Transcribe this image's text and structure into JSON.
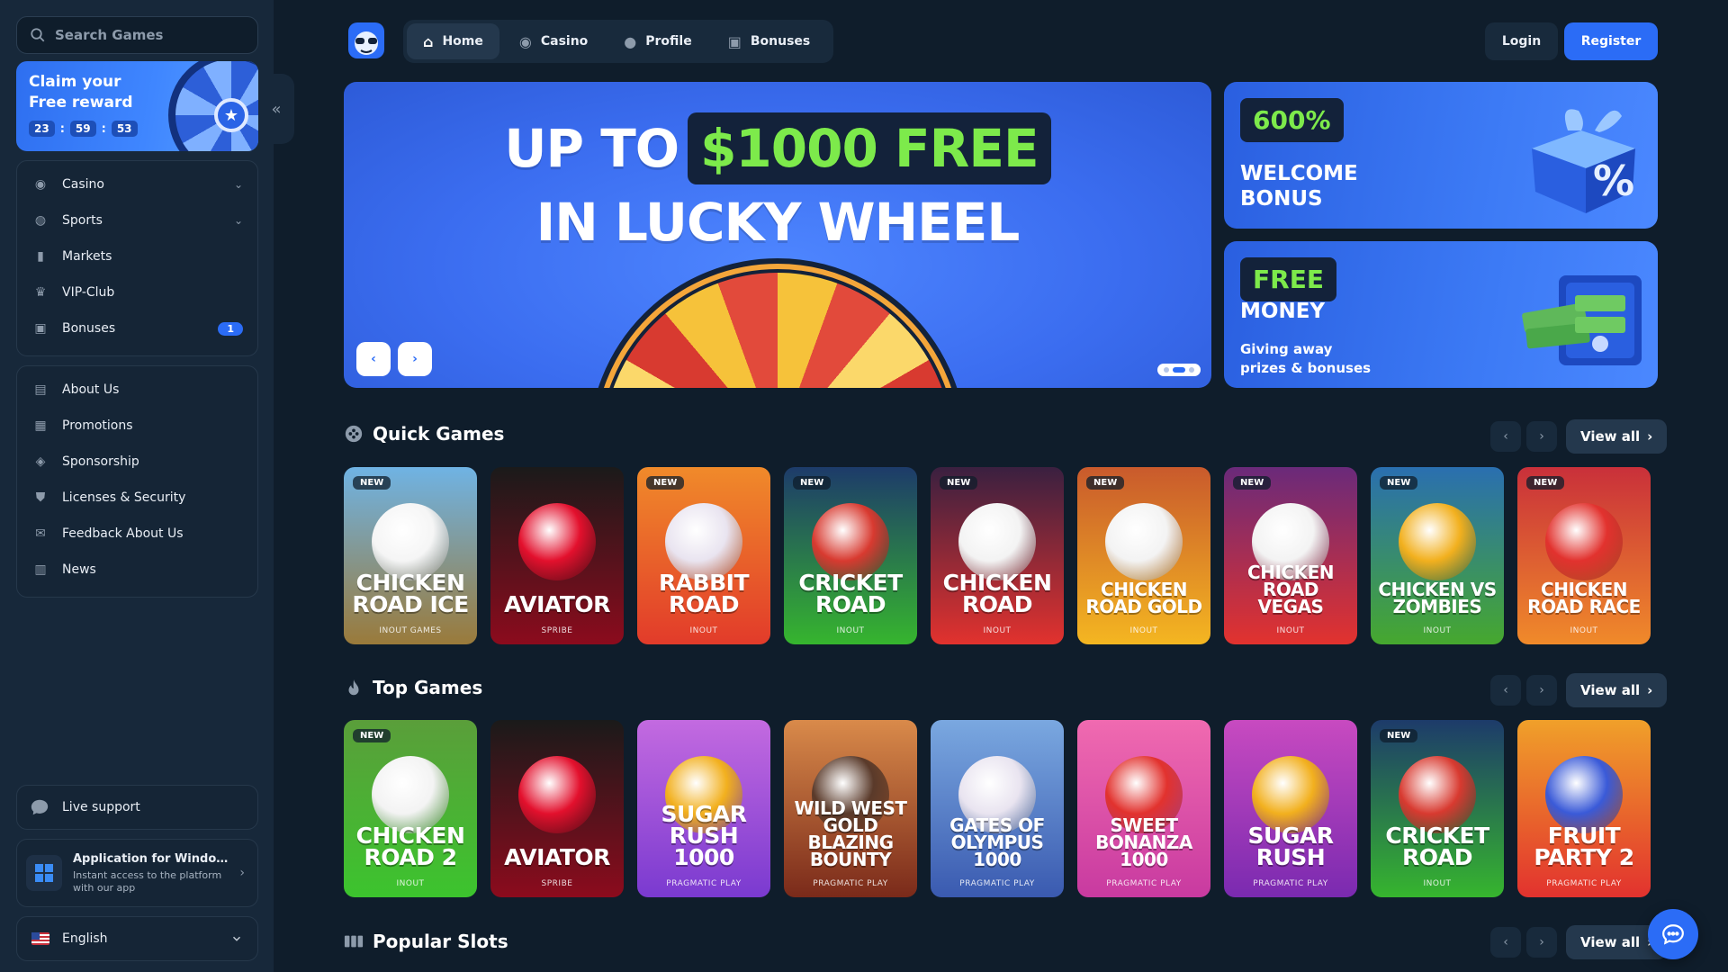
{
  "sidebar": {
    "search_placeholder": "Search Games",
    "claim": {
      "title": "Claim your Free reward",
      "hours": "23",
      "minutes": "59",
      "seconds": "53"
    },
    "nav_primary": [
      {
        "label": "Casino",
        "icon": "casino-chip-icon",
        "expandable": true
      },
      {
        "label": "Sports",
        "icon": "globe-ball-icon",
        "expandable": true
      },
      {
        "label": "Markets",
        "icon": "candles-chart-icon"
      },
      {
        "label": "VIP-Club",
        "icon": "crown-icon"
      },
      {
        "label": "Bonuses",
        "icon": "gift-icon",
        "badge": "1"
      }
    ],
    "nav_secondary": [
      {
        "label": "About Us",
        "icon": "book-icon"
      },
      {
        "label": "Promotions",
        "icon": "ticket-icon"
      },
      {
        "label": "Sponsorship",
        "icon": "medal-icon"
      },
      {
        "label": "Licenses & Security",
        "icon": "shield-icon"
      },
      {
        "label": "Feedback About Us",
        "icon": "chat-bubble-icon"
      },
      {
        "label": "News",
        "icon": "newspaper-icon"
      }
    ],
    "live_support": "Live support",
    "app": {
      "title": "Application for Windows",
      "subtitle": "Instant access to the platform with our app"
    },
    "language": "English"
  },
  "header": {
    "tabs": [
      {
        "label": "Home",
        "icon": "home-icon",
        "active": true
      },
      {
        "label": "Casino",
        "icon": "casino-chip-icon"
      },
      {
        "label": "Profile",
        "icon": "user-icon"
      },
      {
        "label": "Bonuses",
        "icon": "gift-icon"
      }
    ],
    "login": "Login",
    "register": "Register"
  },
  "hero": {
    "line1_a": "UP TO",
    "line1_b": "$1000 FREE",
    "line2": "IN LUCKY WHEEL",
    "slides": 3,
    "active_slide": 2
  },
  "promos": [
    {
      "pill": "600%",
      "title": "WELCOME BONUS",
      "subtitle": ""
    },
    {
      "pill": "FREE",
      "title": "MONEY",
      "subtitle": "Giving away prizes & bonuses"
    }
  ],
  "sections": {
    "quick": {
      "title": "Quick Games",
      "view_all": "View all",
      "games": [
        {
          "name": "CHICKEN ROAD ICE",
          "provider": "INOUT GAMES",
          "new": true,
          "bg": "#6fb3e4",
          "bg2": "#9a7a3a",
          "art": "#f5f5f5"
        },
        {
          "name": "AVIATOR",
          "provider": "SPRIBE",
          "new": false,
          "bg": "#1a1a1a",
          "bg2": "#8c0b1d",
          "art": "#e3102d"
        },
        {
          "name": "RABBIT ROAD",
          "provider": "INOUT",
          "new": true,
          "bg": "#f08a2a",
          "bg2": "#e23b2a",
          "art": "#e9e4f0"
        },
        {
          "name": "CRICKET ROAD",
          "provider": "INOUT",
          "new": true,
          "bg": "#1d3b6a",
          "bg2": "#36b52e",
          "art": "#d83a30"
        },
        {
          "name": "CHICKEN ROAD",
          "provider": "INOUT",
          "new": true,
          "bg": "#3a2040",
          "bg2": "#e2322e",
          "art": "#f3f3f3"
        },
        {
          "name": "CHICKEN ROAD GOLD",
          "provider": "INOUT",
          "new": true,
          "bg": "#c95a2c",
          "bg2": "#f4b621",
          "art": "#f3f3f3"
        },
        {
          "name": "CHICKEN ROAD VEGAS",
          "provider": "INOUT",
          "new": true,
          "bg": "#6a2a7a",
          "bg2": "#e2322e",
          "art": "#f3f3f3"
        },
        {
          "name": "CHICKEN VS ZOMBIES",
          "provider": "INOUT",
          "new": true,
          "bg": "#2a6fb0",
          "bg2": "#46a82e",
          "art": "#f2b01e"
        },
        {
          "name": "CHICKEN ROAD RACE",
          "provider": "INOUT",
          "new": true,
          "bg": "#c9303a",
          "bg2": "#f08a2a",
          "art": "#e2322e"
        }
      ]
    },
    "top": {
      "title": "Top Games",
      "view_all": "View all",
      "games": [
        {
          "name": "CHICKEN ROAD 2",
          "provider": "INOUT",
          "new": true,
          "bg": "#5a9e3a",
          "bg2": "#3cc42e",
          "art": "#f3f3f3"
        },
        {
          "name": "AVIATOR",
          "provider": "SPRIBE",
          "new": false,
          "bg": "#1a1a1a",
          "bg2": "#8c0b1d",
          "art": "#e3102d"
        },
        {
          "name": "SUGAR RUSH 1000",
          "provider": "PRAGMATIC PLAY",
          "new": false,
          "bg": "#c36ae0",
          "bg2": "#7a3ad0",
          "art": "#f2b01e"
        },
        {
          "name": "WILD WEST GOLD BLAZING BOUNTY",
          "provider": "PRAGMATIC PLAY",
          "new": false,
          "bg": "#d98a4a",
          "bg2": "#7a2a1a",
          "art": "#5a3a2a"
        },
        {
          "name": "GATES OF OLYMPUS 1000",
          "provider": "PRAGMATIC PLAY",
          "new": false,
          "bg": "#7aa8e0",
          "bg2": "#3a5ab0",
          "art": "#e9e4f0"
        },
        {
          "name": "SWEET BONANZA 1000",
          "provider": "PRAGMATIC PLAY",
          "new": false,
          "bg": "#f06ab0",
          "bg2": "#c83aa0",
          "art": "#e2322e"
        },
        {
          "name": "SUGAR RUSH",
          "provider": "PRAGMATIC PLAY",
          "new": false,
          "bg": "#c84ac0",
          "bg2": "#7a2ab0",
          "art": "#f2b01e"
        },
        {
          "name": "CRICKET ROAD",
          "provider": "INOUT",
          "new": true,
          "bg": "#1d3b6a",
          "bg2": "#36b52e",
          "art": "#d83a30"
        },
        {
          "name": "FRUIT PARTY 2",
          "provider": "PRAGMATIC PLAY",
          "new": false,
          "bg": "#f0a02a",
          "bg2": "#e2322e",
          "art": "#3a5ad8"
        }
      ]
    },
    "popular": {
      "title": "Popular Slots",
      "view_all": "View all"
    }
  },
  "colors": {
    "accent": "#2b6cf6",
    "bg": "#0f1d2b",
    "sidebar": "#17283a",
    "green_text": "#7dea4b"
  }
}
